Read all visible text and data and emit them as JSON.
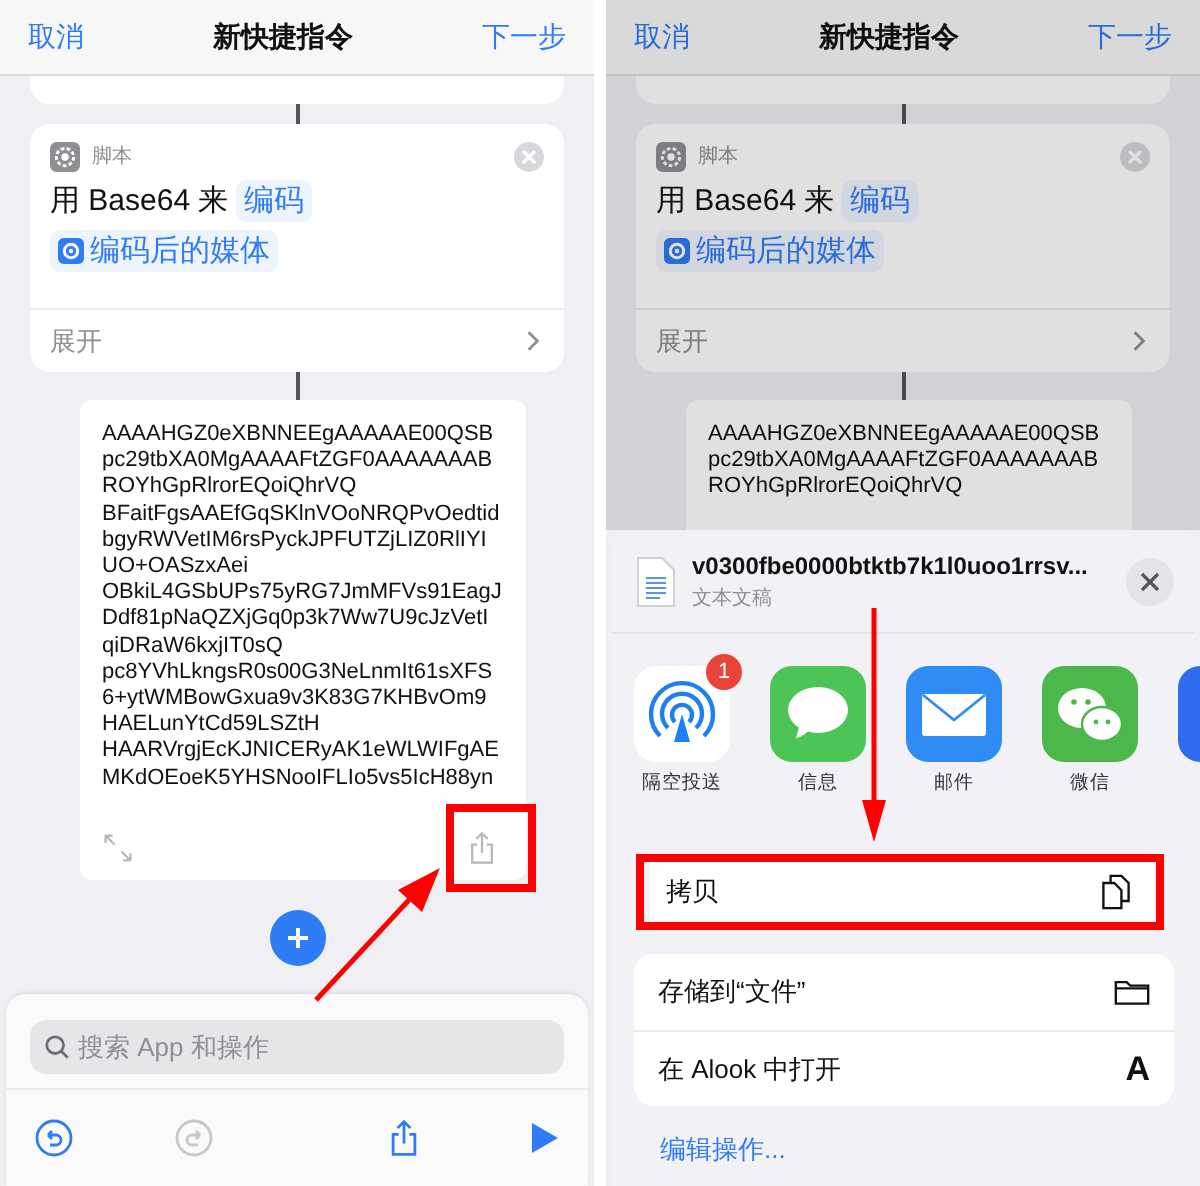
{
  "left_screen": {
    "nav": {
      "cancel": "取消",
      "title": "新快捷指令",
      "next": "下一步"
    },
    "action_card": {
      "category": "脚本",
      "prefix": "用 Base64 来",
      "mode": "编码",
      "variable": "编码后的媒体",
      "expand": "展开"
    },
    "output_text": "AAAAHGZ0eXBNNEEgAAAAAE00QSB\npc29tbXA0MgAAAAFtZGF0AAAAAAAB\nROYhGpRlrorEQoiQhrVQ\nBFaitFgsAAEfGqSKlnVOoNRQPvOedtid\nbgyRWVetIM6rsPyckJPFUTZjLIZ0RlIYI\nUO+OASzxAei\nOBkiL4GSbUPs75yRG7JmMFVs91EagJ\nDdf81pNaQZXjGq0p3k7Ww7U9cJzVetI\nqiDRaW6kxjIT0sQ\npc8YVhLkngsR0s00G3NeLnmIt61sXFS\n6+ytWMBowGxua9v3K83G7KHBvOm9\nHAELunYtCd59LSZtH\nHAARVrgjEcKJNICERyAK1eWLWIFgAE\nMKdOEoeK5YHSNooIFLIo5vs5IcH88yn",
    "search": {
      "placeholder": "搜索 App 和操作"
    },
    "toolbar": [
      {
        "kind": "undo",
        "disabled": false
      },
      {
        "kind": "redo",
        "disabled": true
      },
      {
        "kind": "share",
        "disabled": false
      },
      {
        "kind": "play",
        "disabled": false
      }
    ]
  },
  "right_screen": {
    "nav": {
      "cancel": "取消",
      "title": "新快捷指令",
      "next": "下一步"
    },
    "action_card": {
      "category": "脚本",
      "prefix": "用 Base64 来",
      "mode": "编码",
      "variable": "编码后的媒体",
      "expand": "展开"
    },
    "output_text": "AAAAHGZ0eXBNNEEgAAAAAE00QSB\npc29tbXA0MgAAAAFtZGF0AAAAAAAB\nROYhGpRlrorEQoiQhrVQ",
    "share_sheet": {
      "file_name": "v0300fbe0000btktb7k1l0uoo1rrsv...",
      "file_type": "文本文稿",
      "apps": [
        {
          "kind": "airdrop",
          "label": "隔空投送",
          "badge": "1"
        },
        {
          "kind": "messages",
          "label": "信息"
        },
        {
          "kind": "mail",
          "label": "邮件"
        },
        {
          "kind": "wechat",
          "label": "微信"
        },
        {
          "kind": "partial"
        }
      ],
      "highlighted_action": {
        "kind": "copy",
        "label": "拷贝"
      },
      "actions": [
        {
          "kind": "folder",
          "label": "存储到“文件”"
        },
        {
          "kind": "letter",
          "label": "在 Alook 中打开",
          "icon_char": "A"
        }
      ],
      "edit_link": "编辑操作..."
    }
  }
}
